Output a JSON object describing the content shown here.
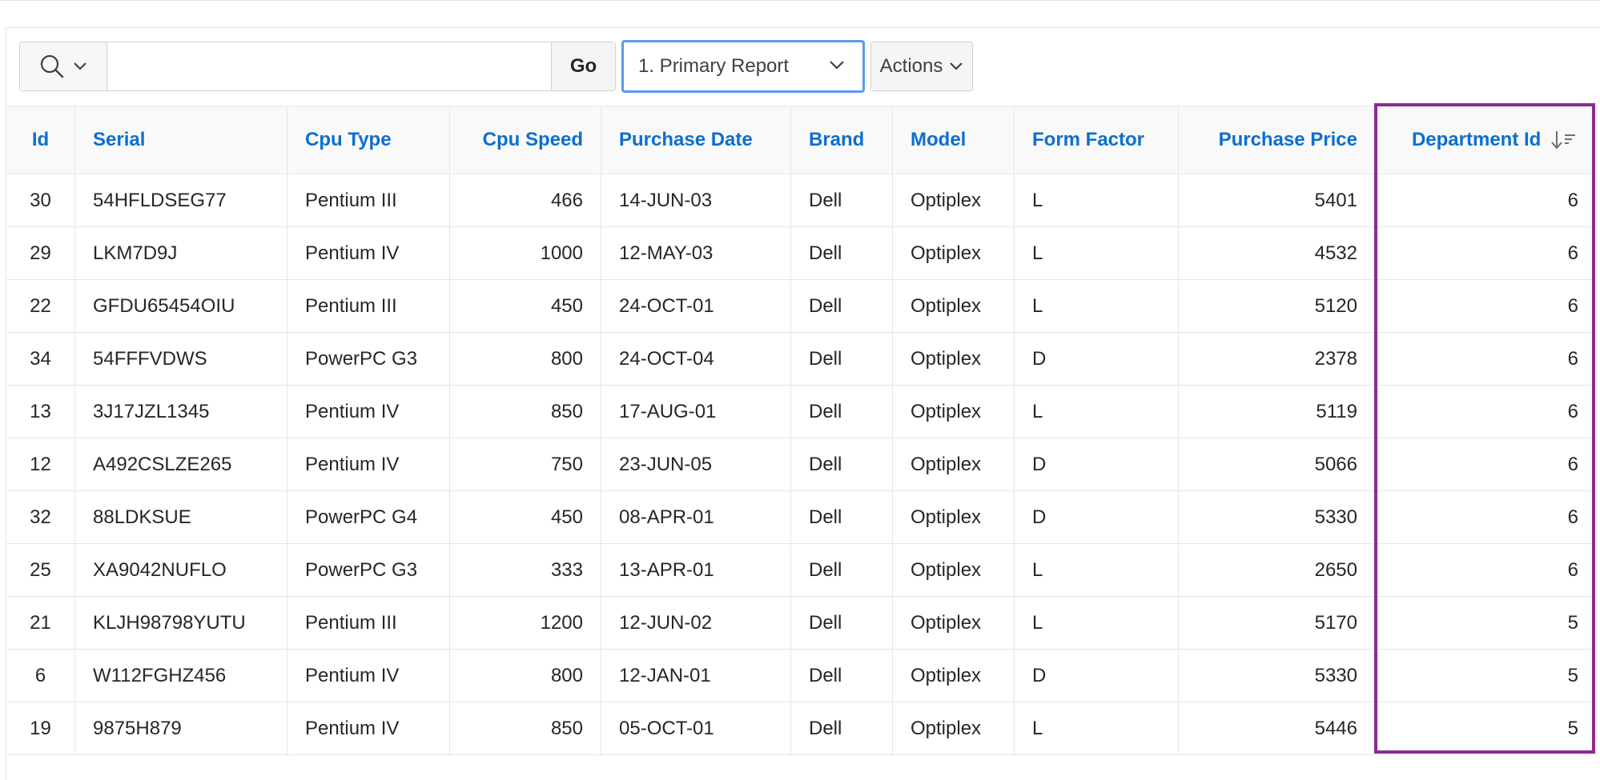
{
  "toolbar": {
    "search_placeholder": "",
    "go_label": "Go",
    "report_selected": "1. Primary Report",
    "actions_label": "Actions"
  },
  "table": {
    "columns": [
      "Id",
      "Serial",
      "Cpu Type",
      "Cpu Speed",
      "Purchase Date",
      "Brand",
      "Model",
      "Form Factor",
      "Purchase Price",
      "Department Id"
    ],
    "sorted_column": "Department Id",
    "sort_direction": "descending",
    "rows": [
      [
        "30",
        "54HFLDSEG77",
        "Pentium III",
        "466",
        "14-JUN-03",
        "Dell",
        "Optiplex",
        "L",
        "5401",
        "6"
      ],
      [
        "29",
        "LKM7D9J",
        "Pentium IV",
        "1000",
        "12-MAY-03",
        "Dell",
        "Optiplex",
        "L",
        "4532",
        "6"
      ],
      [
        "22",
        "GFDU65454OIU",
        "Pentium III",
        "450",
        "24-OCT-01",
        "Dell",
        "Optiplex",
        "L",
        "5120",
        "6"
      ],
      [
        "34",
        "54FFFVDWS",
        "PowerPC G3",
        "800",
        "24-OCT-04",
        "Dell",
        "Optiplex",
        "D",
        "2378",
        "6"
      ],
      [
        "13",
        "3J17JZL1345",
        "Pentium IV",
        "850",
        "17-AUG-01",
        "Dell",
        "Optiplex",
        "L",
        "5119",
        "6"
      ],
      [
        "12",
        "A492CSLZE265",
        "Pentium IV",
        "750",
        "23-JUN-05",
        "Dell",
        "Optiplex",
        "D",
        "5066",
        "6"
      ],
      [
        "32",
        "88LDKSUE",
        "PowerPC G4",
        "450",
        "08-APR-01",
        "Dell",
        "Optiplex",
        "D",
        "5330",
        "6"
      ],
      [
        "25",
        "XA9042NUFLO",
        "PowerPC G3",
        "333",
        "13-APR-01",
        "Dell",
        "Optiplex",
        "L",
        "2650",
        "6"
      ],
      [
        "21",
        "KLJH98798YUTU",
        "Pentium III",
        "1200",
        "12-JUN-02",
        "Dell",
        "Optiplex",
        "L",
        "5170",
        "5"
      ],
      [
        "6",
        "W112FGHZ456",
        "Pentium IV",
        "800",
        "12-JAN-01",
        "Dell",
        "Optiplex",
        "D",
        "5330",
        "5"
      ],
      [
        "19",
        "9875H879",
        "Pentium IV",
        "850",
        "05-OCT-01",
        "Dell",
        "Optiplex",
        "L",
        "5446",
        "5"
      ]
    ]
  },
  "colors": {
    "header_link": "#0b6fd0",
    "focus_border": "#5a9ae8",
    "highlight_border": "#8a2a92"
  },
  "icons": {
    "search_menu": "search-icon",
    "dropdown": "chevron-down-icon",
    "sort": "sort-descending-icon"
  }
}
